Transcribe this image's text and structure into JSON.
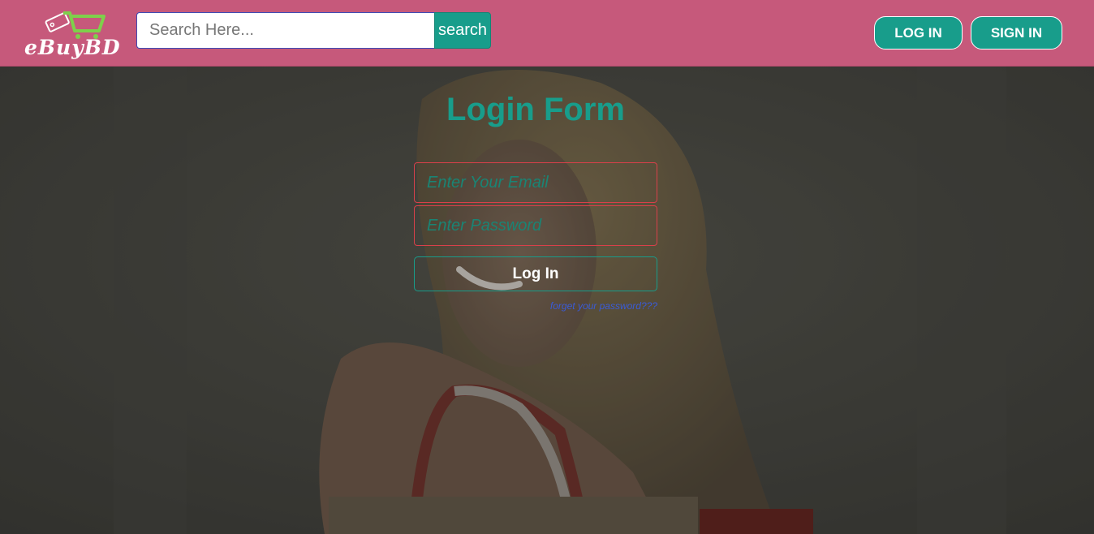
{
  "header": {
    "logo_text": "eBuyBD",
    "search": {
      "placeholder": "Search Here...",
      "button_label": "search"
    },
    "login_label": "LOG IN",
    "signin_label": "SIGN IN"
  },
  "form": {
    "title": "Login Form",
    "email_placeholder": "Enter Your Email",
    "password_placeholder": "Enter Password",
    "submit_label": "Log In",
    "forget_link": "forget your password???"
  },
  "colors": {
    "header_bg": "#c6597b",
    "accent": "#189d8b",
    "field_border": "#d9404a",
    "link": "#3a5bd6"
  }
}
